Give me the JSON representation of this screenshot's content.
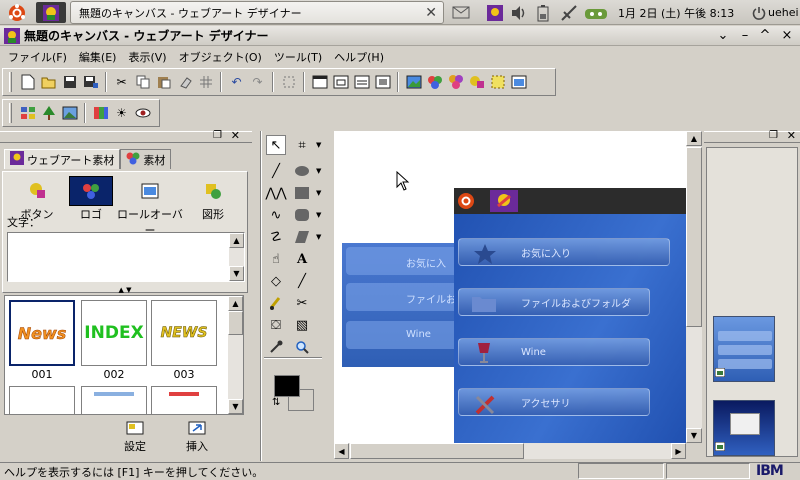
{
  "panel": {
    "task_title": "無題のキャンバス - ウェブアート デザイナー",
    "clock": "1月 2日 (土) 午後 8:13",
    "user": "uehei"
  },
  "window": {
    "title": "無題のキャンバス - ウェブアート デザイナー",
    "controls": [
      "⌄",
      "–",
      "^",
      "×"
    ]
  },
  "menu": [
    "ファイル(F)",
    "編集(E)",
    "表示(V)",
    "オブジェクト(O)",
    "ツール(T)",
    "ヘルプ(H)"
  ],
  "left_panel": {
    "tabs": [
      "ウェブアート素材",
      "素材"
    ],
    "categories": [
      "ボタン",
      "ロゴ",
      "ロールオーバー",
      "図形"
    ],
    "text_label": "文字：",
    "thumbnails": [
      {
        "label": "001",
        "art": "News"
      },
      {
        "label": "002",
        "art": "INDEX"
      },
      {
        "label": "003",
        "art": "NEWS"
      }
    ],
    "settings_label": "設定",
    "insert_label": "挿入"
  },
  "canvas_content": {
    "menu_items": [
      "お気に入り",
      "ファイルおよびフォルダ",
      "Wine",
      "アクセサリ"
    ],
    "ghost_items": [
      "お気に入",
      "ファイルお",
      "Wine"
    ]
  },
  "status": {
    "text": "ヘルプを表示するには [F1] キーを押してください。",
    "brand": "IBM"
  },
  "colors": {
    "accent_blue": "#2f5fb5",
    "panel_bg": "#d4d0c8",
    "fg_color": "#000000",
    "bg_color": "#ffffff"
  }
}
